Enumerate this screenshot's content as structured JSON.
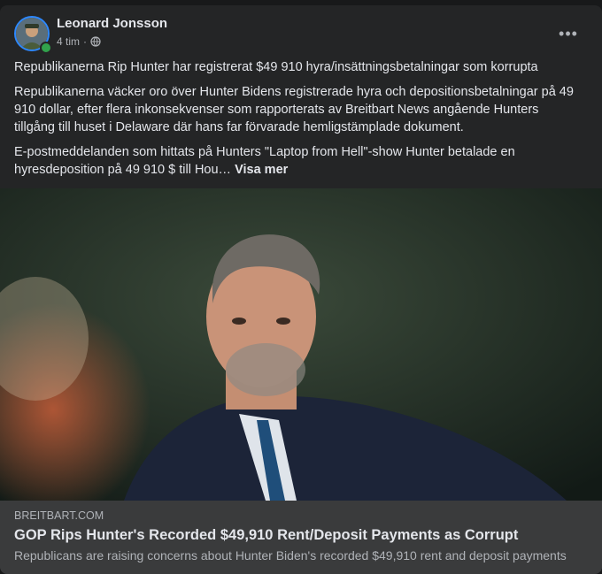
{
  "post": {
    "author": "Leonard Jonsson",
    "time": "4 tim",
    "separator": "·",
    "privacy_icon": "globe-icon",
    "more_icon": "more-horizontal-icon",
    "more_label": "•••",
    "paragraphs": [
      "Republikanerna Rip Hunter har registrerat $49 910 hyra/insättningsbetalningar som korrupta",
      "Republikanerna väcker oro över Hunter Bidens registrerade hyra och depositionsbetalningar på 49 910 dollar, efter flera inkonsekvenser som rapporterats av Breitbart News angående Hunters tillgång till huset i Delaware där hans far förvarade hemligstämplade dokument.",
      "E-postmeddelanden som hittats på Hunters \"Laptop from Hell\"-show Hunter betalade en hyresdeposition på 49 910 $ till Hou…"
    ],
    "see_more": "Visa mer"
  },
  "link": {
    "domain": "BREITBART.COM",
    "title": "GOP Rips Hunter's Recorded $49,910 Rent/Deposit Payments as Corrupt",
    "description": "Republicans are raising concerns about Hunter Biden's recorded $49,910 rent and deposit payments"
  },
  "colors": {
    "background": "#18191a",
    "card": "#242526",
    "link_bg": "#3a3b3c",
    "primary_text": "#e4e6eb",
    "secondary_text": "#b0b3b8",
    "online": "#31a24c",
    "avatar_ring": "#2d88ff"
  }
}
